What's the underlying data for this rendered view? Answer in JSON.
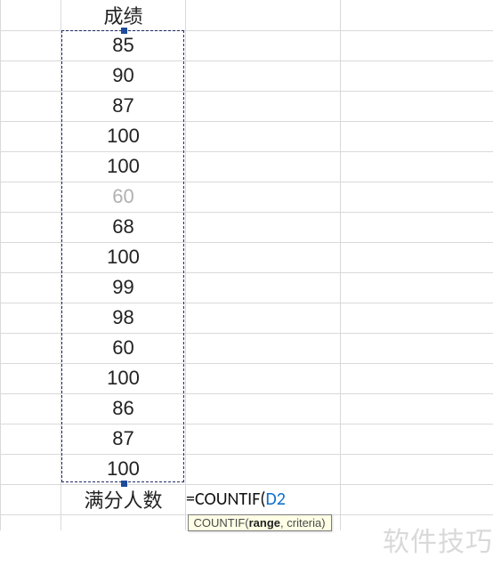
{
  "header": {
    "label": "成绩"
  },
  "scores": [
    {
      "v": "85",
      "faint": false
    },
    {
      "v": "90",
      "faint": false
    },
    {
      "v": "87",
      "faint": false
    },
    {
      "v": "100",
      "faint": false
    },
    {
      "v": "100",
      "faint": false
    },
    {
      "v": "60",
      "faint": true
    },
    {
      "v": "68",
      "faint": false
    },
    {
      "v": "100",
      "faint": false
    },
    {
      "v": "99",
      "faint": false
    },
    {
      "v": "98",
      "faint": false
    },
    {
      "v": "60",
      "faint": false
    },
    {
      "v": "100",
      "faint": false
    },
    {
      "v": "86",
      "faint": false
    },
    {
      "v": "87",
      "faint": false
    },
    {
      "v": "100",
      "faint": false
    }
  ],
  "summary": {
    "label": "满分人数"
  },
  "formula": {
    "prefix": "=COUNTIF(",
    "range_ref": "D2",
    "tooltip_fn": "COUNTIF(",
    "tooltip_bold": "range",
    "tooltip_rest": ", criteria)"
  },
  "watermark": "软件技巧",
  "chart_data": {
    "type": "table",
    "title": "成绩",
    "values": [
      85,
      90,
      87,
      100,
      100,
      60,
      68,
      100,
      99,
      98,
      60,
      100,
      86,
      87,
      100
    ],
    "summary_label": "满分人数",
    "formula": "=COUNTIF(D2"
  }
}
